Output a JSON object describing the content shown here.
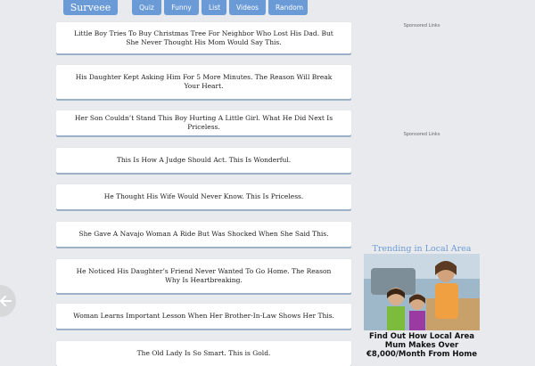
{
  "header": {
    "logo": "Surveee",
    "nav": [
      "Quiz",
      "Funny",
      "List",
      "Videos",
      "Random"
    ]
  },
  "articles": [
    "Little Boy Tries To Buy Christmas Tree For Neighbor Who Lost His Dad. But She Never Thought His Mom Would Say This.",
    "His Daughter Kept Asking Him For 5 More Minutes. The Reason Will Break Your Heart.",
    "Her Son Couldn’t Stand This Boy Hurting A Little Girl. What He Did Next Is Priceless.",
    "This Is How A Judge Should Act. This Is Wonderful.",
    "He Thought His Wife Would Never Know. This Is Priceless.",
    "She Gave A Navajo Woman A Ride But Was Shocked When She Said This.",
    "He Noticed His Daughter’s Friend Never Wanted To Go Home. The Reason Why Is Heartbreaking.",
    "Woman Learns Important Lesson When Her Brother-In-Law Shows Her This.",
    "The Old Lady Is So Smart. This is Gold."
  ],
  "sidebar": {
    "sponsored_1": "Sponsored Links",
    "sponsored_2": "Sponsored Links",
    "trending_title": "Trending in Local Area",
    "ad_text": "Find Out How Local Area Mum Makes Over €8,000/Month From Home"
  },
  "colors": {
    "accent": "#6b9bd6",
    "background": "#e9eaee"
  },
  "icons": {
    "back": "arrow-left-icon"
  }
}
